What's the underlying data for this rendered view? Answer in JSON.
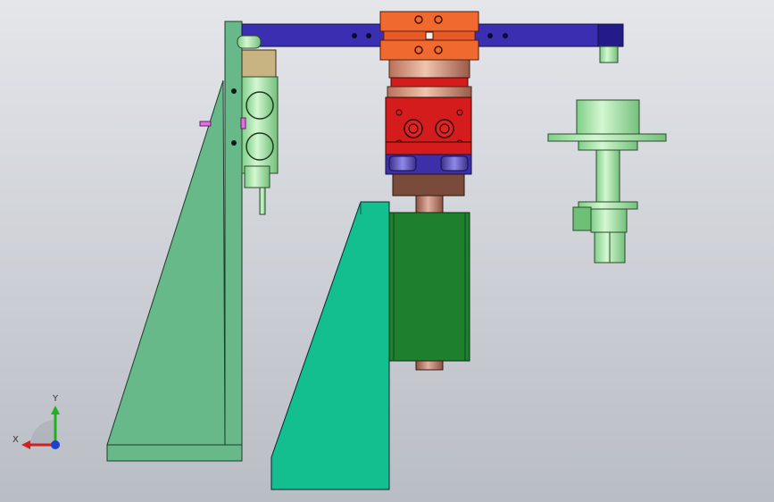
{
  "viewport": {
    "background_top": "#e4e6ea",
    "background_bottom": "#b9bdc4"
  },
  "parts": [
    "left-support-plate",
    "center-support-plate",
    "top-arm",
    "top-clamp-block",
    "rotary-actuator",
    "motor-housing",
    "right-cylinder-assembly",
    "solenoid-valve-block"
  ],
  "colors": {
    "left_plate": "#67b98a",
    "center_plate": "#13bf8e",
    "arm": "#3a2fb0",
    "clamp": "#f06a30",
    "actuator_red": "#d41c1c",
    "motor_green": "#1e7f2e",
    "light_green_part": "#9fe3a5",
    "bronze": "#c98866"
  },
  "triad": {
    "x_label": "X",
    "y_label": "Y",
    "x_color": "#d02020",
    "y_color": "#20b020",
    "z_color": "#2040d0"
  }
}
